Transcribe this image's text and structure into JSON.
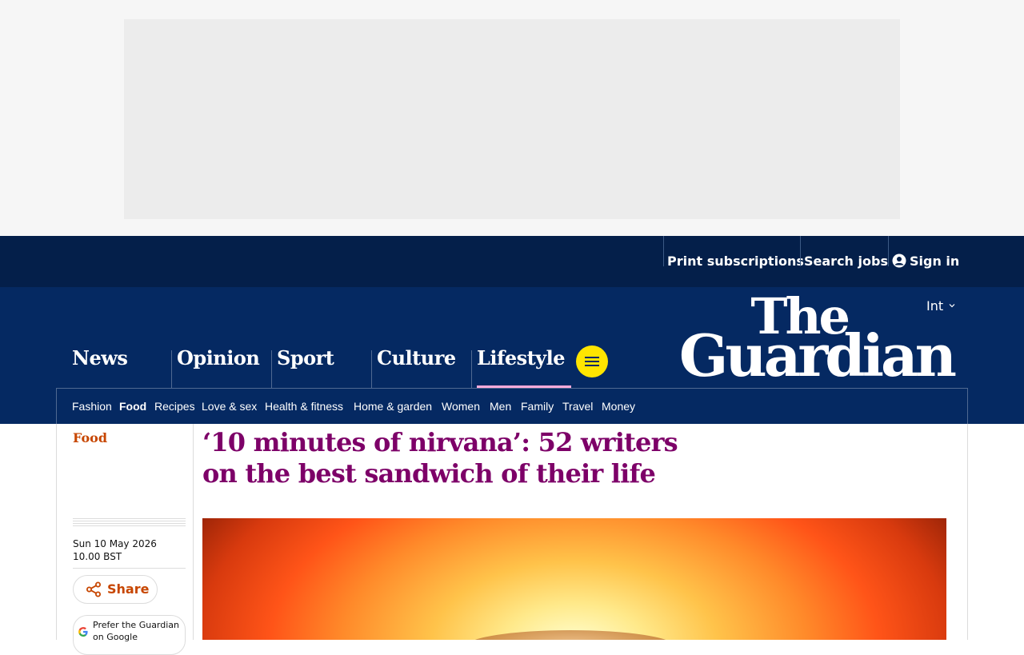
{
  "topbar": {
    "links": [
      "Print subscriptions",
      "Search jobs",
      "Sign in"
    ]
  },
  "header": {
    "edition": "Int",
    "logo_line1": "The",
    "logo_line2": "Guardian",
    "pillars": [
      "News",
      "Opinion",
      "Sport",
      "Culture",
      "Lifestyle"
    ],
    "active_pillar": "Lifestyle",
    "subnav": [
      "Fashion",
      "Food",
      "Recipes",
      "Love & sex",
      "Health & fitness",
      "Home & garden",
      "Women",
      "Men",
      "Family",
      "Travel",
      "Money"
    ],
    "active_subnav": "Food"
  },
  "article": {
    "section": "Food",
    "headline": "‘10 minutes of nirvana’: 52 writers on the best sandwich of their life",
    "dateline": "Sun 10 May 2026 10.00 BST",
    "share_label": "Share",
    "google_text": "Prefer the Guardian on Google"
  },
  "colors": {
    "brand_dark": "#041f4a",
    "brand": "#052962",
    "lifestyle_accent": "#7d0068",
    "food_accent": "#c74600",
    "menu_yellow": "#ffe500",
    "lifestyle_underline": "#ffabdb"
  },
  "icons": {
    "user": "user-icon",
    "menu": "hamburger-menu-icon",
    "share": "share-icon",
    "google": "google-g-icon",
    "edition": "chevron-down-icon"
  }
}
